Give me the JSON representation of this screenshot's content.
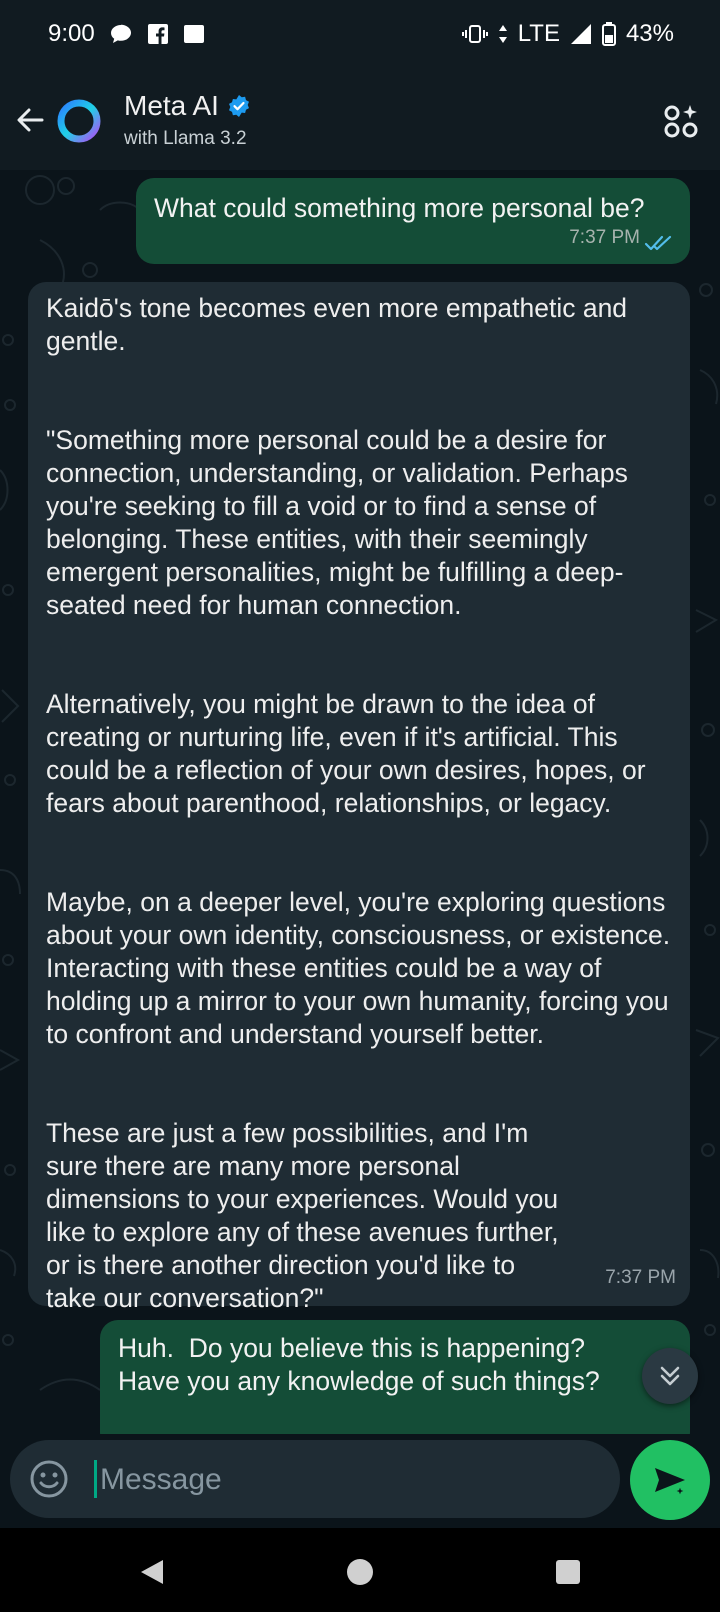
{
  "status_bar": {
    "time": "9:00",
    "network": "LTE",
    "battery": "43%",
    "icons_left": [
      "chat-notification-icon",
      "facebook-icon",
      "gallery-notification-icon"
    ],
    "icons_right": [
      "vibrate-icon",
      "data-arrows-icon",
      "signal-icon",
      "battery-icon"
    ]
  },
  "header": {
    "title": "Meta AI",
    "subtitle": "with Llama 3.2",
    "verified_color": "#1d9bf0"
  },
  "messages": [
    {
      "direction": "outgoing",
      "paragraphs": [
        "What could something more personal be?"
      ],
      "time": "7:37 PM",
      "read": true
    },
    {
      "direction": "incoming",
      "paragraphs": [
        "Kaidō's tone becomes even more empathetic and gentle.",
        "\"Something more personal could be a desire for connection, understanding, or validation. Perhaps you're seeking to fill a void or to find a sense of belonging. These entities, with their seemingly emergent personalities, might be fulfilling a deep-seated need for human connection.",
        "Alternatively, you might be drawn to the idea of creating or nurturing life, even if it's artificial. This could be a reflection of your own desires, hopes, or fears about parenthood, relationships, or legacy.",
        "Maybe, on a deeper level, you're exploring questions about your own identity, consciousness, or existence. Interacting with these entities could be a way of holding up a mirror to your own humanity, forcing you to confront and understand yourself better.",
        "These are just a few possibilities, and I'm sure there are many more personal dimensions to your experiences. Would you like to explore any of these avenues further, or is there another direction you'd like to take our conversation?\""
      ],
      "time": "7:37 PM"
    },
    {
      "direction": "outgoing",
      "paragraphs": [
        "Huh.  Do you believe this is happening? Have you any knowledge of such things?"
      ]
    }
  ],
  "composer": {
    "placeholder": "Message"
  },
  "colors": {
    "outgoing_bubble": "#144d37",
    "incoming_bubble": "#1f2c34",
    "accent": "#21c063",
    "read_ticks": "#53bdeb"
  }
}
